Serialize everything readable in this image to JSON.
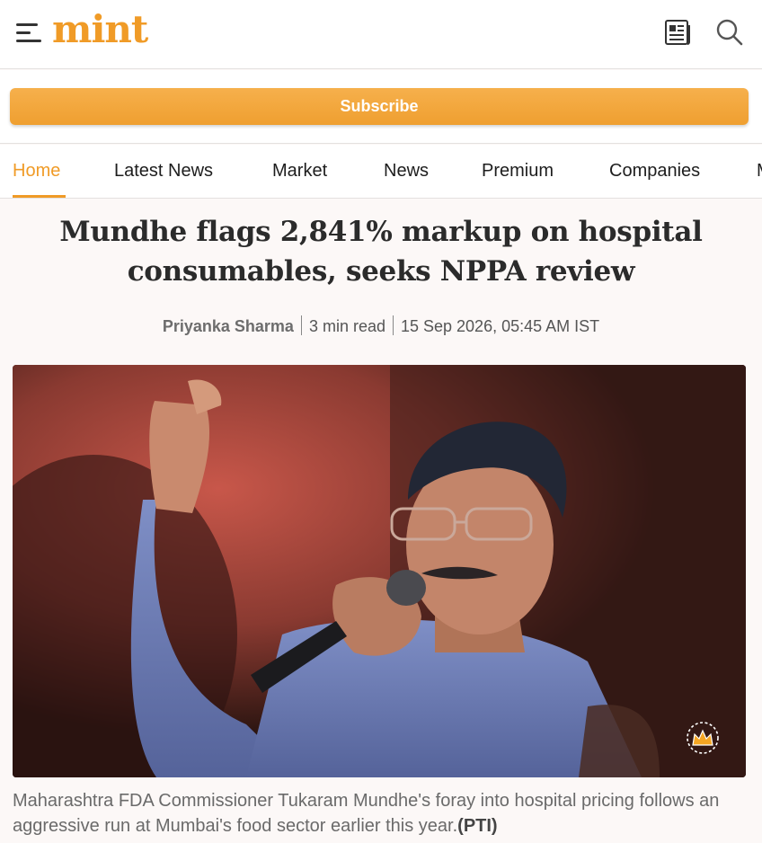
{
  "header": {
    "logo_text": "mint",
    "menu_icon": "hamburger-menu-icon",
    "newspaper_icon": "newspaper-icon",
    "search_icon": "search-icon"
  },
  "subscribe": {
    "label": "Subscribe"
  },
  "nav": {
    "items": [
      {
        "label": "Home",
        "active": true
      },
      {
        "label": "Latest News"
      },
      {
        "label": "Market"
      },
      {
        "label": "News"
      },
      {
        "label": "Premium"
      },
      {
        "label": "Companies"
      },
      {
        "label": "M"
      }
    ]
  },
  "article": {
    "headline_line1": "Mundhe flags 2,841% markup on hospital",
    "headline_line2": "consumables, seeks NPPA review",
    "author": "Priyanka Sharma",
    "read_time": "3 min read",
    "published": "15 Sep 2026, 05:45 AM IST",
    "premium_icon": "crown-icon",
    "caption": "Maharashtra FDA Commissioner Tukaram Mundhe's foray into hospital pricing follows an aggressive run at Mumbai's food sector earlier this year.",
    "caption_credit": "(PTI)"
  },
  "colors": {
    "accent": "#f09b27",
    "background": "#fcf8f7"
  }
}
